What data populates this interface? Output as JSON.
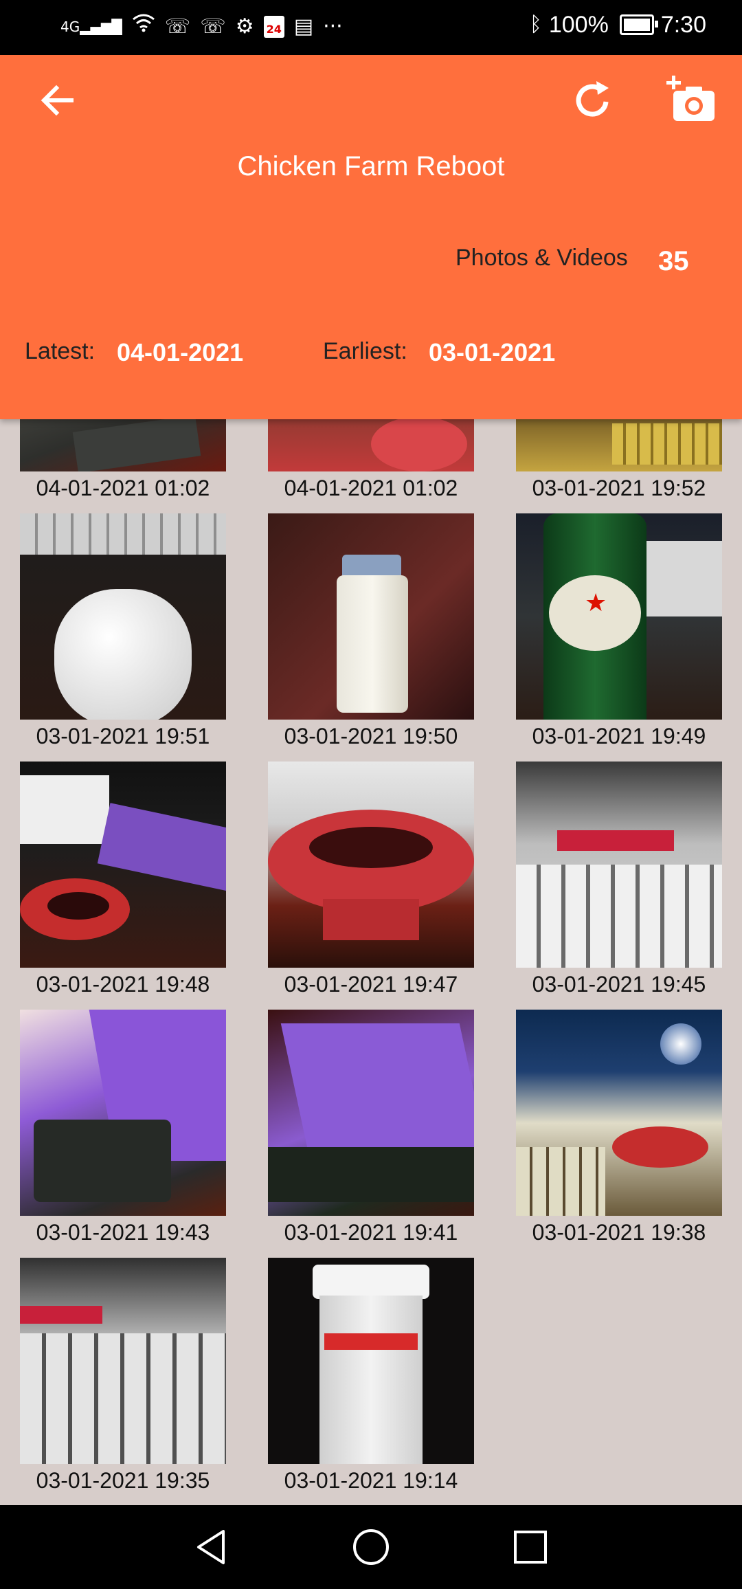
{
  "status_bar": {
    "network": "4G",
    "calendar_day": "24",
    "battery": "100%",
    "time": "7:30",
    "overflow": "···"
  },
  "header": {
    "title": "Chicken Farm Reboot",
    "photos_label": "Photos & Videos",
    "photos_count": "35",
    "latest_label": "Latest:",
    "latest_value": "04-01-2021",
    "earliest_label": "Earliest:",
    "earliest_value": "03-01-2021",
    "color": "#ff6f3d"
  },
  "photos": [
    {
      "caption": "04-01-2021 01:02",
      "subject": "laptop corner"
    },
    {
      "caption": "04-01-2021 01:02",
      "subject": "cables"
    },
    {
      "caption": "03-01-2021 19:52",
      "subject": "gold keyboard"
    },
    {
      "caption": "03-01-2021 19:51",
      "subject": "white mouse"
    },
    {
      "caption": "03-01-2021 19:50",
      "subject": "lighter"
    },
    {
      "caption": "03-01-2021 19:49",
      "subject": "beer bottle"
    },
    {
      "caption": "03-01-2021 19:48",
      "subject": "headphone pad and phone case"
    },
    {
      "caption": "03-01-2021 19:47",
      "subject": "red headphone pad"
    },
    {
      "caption": "03-01-2021 19:45",
      "subject": "keyboard"
    },
    {
      "caption": "03-01-2021 19:43",
      "subject": "purple phone case"
    },
    {
      "caption": "03-01-2021 19:41",
      "subject": "purple phone case"
    },
    {
      "caption": "03-01-2021 19:38",
      "subject": "monitor"
    },
    {
      "caption": "03-01-2021 19:35",
      "subject": "keyboard"
    },
    {
      "caption": "03-01-2021 19:14",
      "subject": "pill bottle"
    }
  ]
}
